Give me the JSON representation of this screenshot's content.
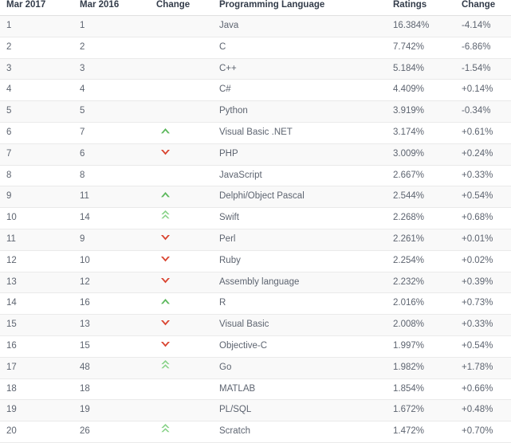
{
  "table": {
    "headers": {
      "rank_now": "Mar 2017",
      "rank_prev": "Mar 2016",
      "change": "Change",
      "language": "Programming Language",
      "ratings": "Ratings",
      "delta": "Change"
    },
    "colors": {
      "up_single": "#5cb85c",
      "up_double": "#85d185",
      "down_single": "#d9432f",
      "header_text": "#333c4a",
      "body_text": "#5d6470",
      "row_stripe": "#f9f9f9",
      "row_plain": "#ffffff",
      "row_border": "#eaeaea"
    },
    "rows": [
      {
        "rank_now": "1",
        "rank_prev": "1",
        "change": "",
        "language": "Java",
        "ratings": "16.384%",
        "delta": "-4.14%"
      },
      {
        "rank_now": "2",
        "rank_prev": "2",
        "change": "",
        "language": "C",
        "ratings": "7.742%",
        "delta": "-6.86%"
      },
      {
        "rank_now": "3",
        "rank_prev": "3",
        "change": "",
        "language": "C++",
        "ratings": "5.184%",
        "delta": "-1.54%"
      },
      {
        "rank_now": "4",
        "rank_prev": "4",
        "change": "",
        "language": "C#",
        "ratings": "4.409%",
        "delta": "+0.14%"
      },
      {
        "rank_now": "5",
        "rank_prev": "5",
        "change": "",
        "language": "Python",
        "ratings": "3.919%",
        "delta": "-0.34%"
      },
      {
        "rank_now": "6",
        "rank_prev": "7",
        "change": "up-single",
        "language": "Visual Basic .NET",
        "ratings": "3.174%",
        "delta": "+0.61%"
      },
      {
        "rank_now": "7",
        "rank_prev": "6",
        "change": "down-single",
        "language": "PHP",
        "ratings": "3.009%",
        "delta": "+0.24%"
      },
      {
        "rank_now": "8",
        "rank_prev": "8",
        "change": "",
        "language": "JavaScript",
        "ratings": "2.667%",
        "delta": "+0.33%"
      },
      {
        "rank_now": "9",
        "rank_prev": "11",
        "change": "up-single",
        "language": "Delphi/Object Pascal",
        "ratings": "2.544%",
        "delta": "+0.54%"
      },
      {
        "rank_now": "10",
        "rank_prev": "14",
        "change": "up-double",
        "language": "Swift",
        "ratings": "2.268%",
        "delta": "+0.68%"
      },
      {
        "rank_now": "11",
        "rank_prev": "9",
        "change": "down-single",
        "language": "Perl",
        "ratings": "2.261%",
        "delta": "+0.01%"
      },
      {
        "rank_now": "12",
        "rank_prev": "10",
        "change": "down-single",
        "language": "Ruby",
        "ratings": "2.254%",
        "delta": "+0.02%"
      },
      {
        "rank_now": "13",
        "rank_prev": "12",
        "change": "down-single",
        "language": "Assembly language",
        "ratings": "2.232%",
        "delta": "+0.39%"
      },
      {
        "rank_now": "14",
        "rank_prev": "16",
        "change": "up-single",
        "language": "R",
        "ratings": "2.016%",
        "delta": "+0.73%"
      },
      {
        "rank_now": "15",
        "rank_prev": "13",
        "change": "down-single",
        "language": "Visual Basic",
        "ratings": "2.008%",
        "delta": "+0.33%"
      },
      {
        "rank_now": "16",
        "rank_prev": "15",
        "change": "down-single",
        "language": "Objective-C",
        "ratings": "1.997%",
        "delta": "+0.54%"
      },
      {
        "rank_now": "17",
        "rank_prev": "48",
        "change": "up-double",
        "language": "Go",
        "ratings": "1.982%",
        "delta": "+1.78%"
      },
      {
        "rank_now": "18",
        "rank_prev": "18",
        "change": "",
        "language": "MATLAB",
        "ratings": "1.854%",
        "delta": "+0.66%"
      },
      {
        "rank_now": "19",
        "rank_prev": "19",
        "change": "",
        "language": "PL/SQL",
        "ratings": "1.672%",
        "delta": "+0.48%"
      },
      {
        "rank_now": "20",
        "rank_prev": "26",
        "change": "up-double",
        "language": "Scratch",
        "ratings": "1.472%",
        "delta": "+0.70%"
      }
    ]
  }
}
